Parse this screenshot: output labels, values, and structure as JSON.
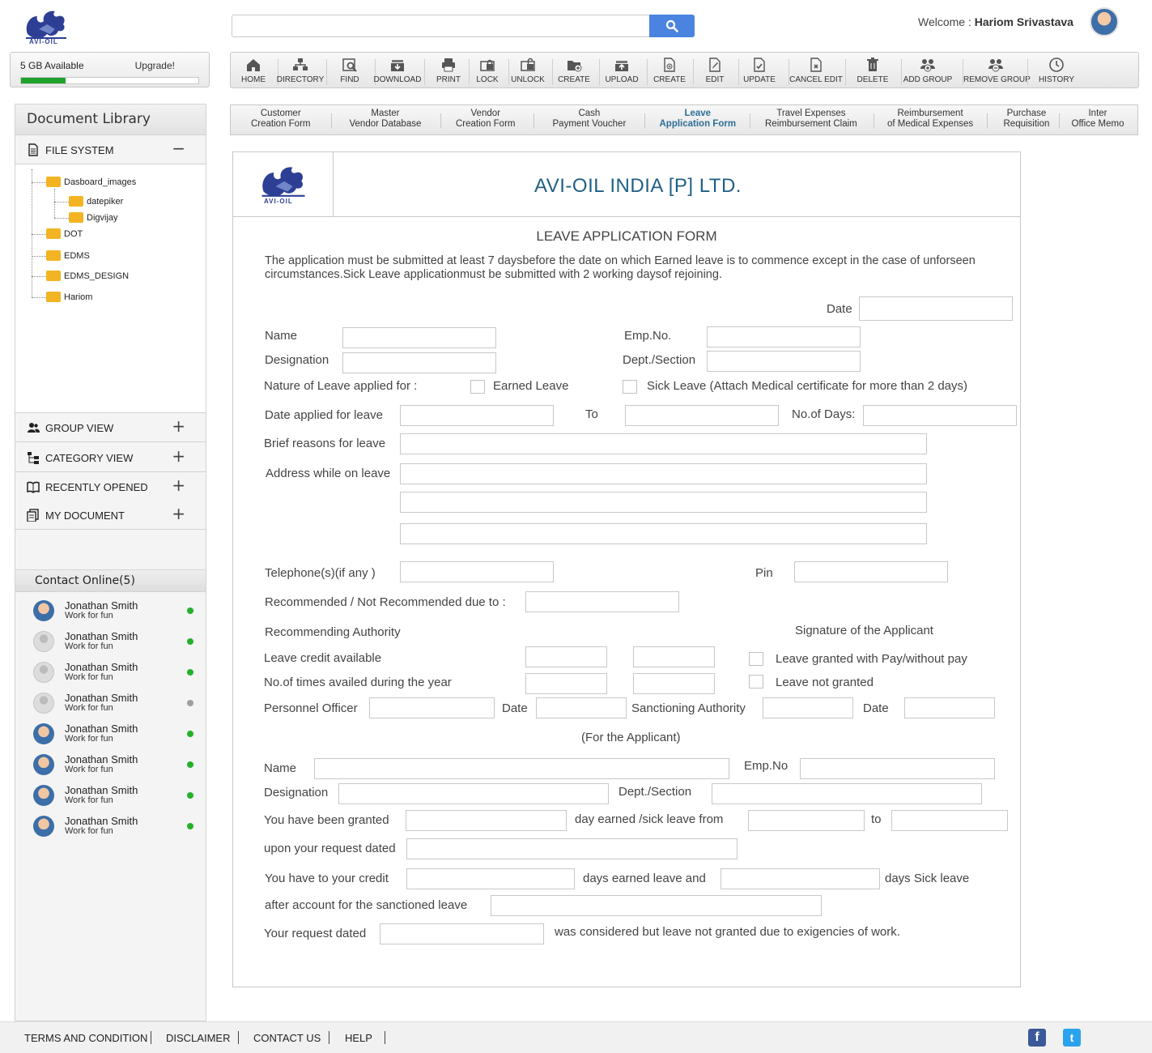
{
  "brand": {
    "logo_text": "AVI-OIL"
  },
  "storage": {
    "label": "5 GB Available",
    "upgrade": "Upgrade!",
    "used_fraction": 0.25
  },
  "search": {
    "placeholder": "",
    "value": ""
  },
  "user": {
    "welcome_label": "Welcome :",
    "name": "Hariom Srivastava"
  },
  "toolbar": [
    {
      "label": "HOME",
      "icon": "home-icon"
    },
    {
      "label": "DIRECTORY",
      "icon": "directory-icon"
    },
    {
      "label": "FIND",
      "icon": "find-icon"
    },
    {
      "label": "DOWNLOAD",
      "icon": "download-icon"
    },
    {
      "label": "PRINT",
      "icon": "print-icon"
    },
    {
      "label": "LOCK",
      "icon": "lock-icon"
    },
    {
      "label": "UNLOCK",
      "icon": "unlock-icon"
    },
    {
      "label": "CREATE",
      "icon": "create-folder-icon"
    },
    {
      "label": "UPLOAD",
      "icon": "upload-icon"
    },
    {
      "label": "CREATE",
      "icon": "create-document-icon"
    },
    {
      "label": "EDIT",
      "icon": "edit-icon"
    },
    {
      "label": "UPDATE",
      "icon": "update-icon"
    },
    {
      "label": "CANCEL EDIT",
      "icon": "cancel-edit-icon"
    },
    {
      "label": "DELETE",
      "icon": "delete-icon"
    },
    {
      "label": "ADD GROUP",
      "icon": "add-group-icon"
    },
    {
      "label": "REMOVE GROUP",
      "icon": "remove-group-icon"
    },
    {
      "label": "HISTORY",
      "icon": "history-icon"
    }
  ],
  "tabs": [
    {
      "line1": "Customer",
      "line2": "Creation Form"
    },
    {
      "line1": "Master",
      "line2": "Vendor Database"
    },
    {
      "line1": "Vendor",
      "line2": "Creation Form"
    },
    {
      "line1": "Cash",
      "line2": "Payment Voucher"
    },
    {
      "line1": "Leave",
      "line2": "Application Form",
      "active": true
    },
    {
      "line1": "Travel Expenses",
      "line2": "Reimbursement Claim"
    },
    {
      "line1": "Reimbursement",
      "line2": "of Medical Expenses"
    },
    {
      "line1": "Purchase",
      "line2": "Requisition"
    },
    {
      "line1": "Inter",
      "line2": "Office Memo"
    }
  ],
  "sidebar": {
    "title": "Document Library",
    "file_system": "FILE SYSTEM",
    "tree": [
      "Dasboard_images",
      "datepiker",
      "Digvijay",
      "DOT",
      "EDMS",
      "EDMS_DESIGN",
      "Hariom"
    ],
    "sections": [
      "GROUP VIEW",
      "CATEGORY VIEW",
      "RECENTLY OPENED",
      "MY DOCUMENT"
    ],
    "contacts_title": "Contact Online(5)",
    "contacts": [
      {
        "name": "Jonathan Smith",
        "status": "Work for fun",
        "online": true
      },
      {
        "name": "Jonathan Smith",
        "status": "Work for fun",
        "online": true
      },
      {
        "name": "Jonathan Smith",
        "status": "Work for fun",
        "online": true
      },
      {
        "name": "Jonathan Smith",
        "status": "Work for fun",
        "online": false
      },
      {
        "name": "Jonathan Smith",
        "status": "Work for fun",
        "online": true
      },
      {
        "name": "Jonathan Smith",
        "status": "Work for fun",
        "online": true
      },
      {
        "name": "Jonathan Smith",
        "status": "Work for fun",
        "online": true
      },
      {
        "name": "Jonathan Smith",
        "status": "Work for fun",
        "online": true
      }
    ]
  },
  "form": {
    "company": "AVI-OIL INDIA [P] LTD.",
    "title": "LEAVE APPLICATION FORM",
    "instructions": "The application must be submitted at least 7 daysbefore the date on which Earned leave is to commence except in the case of unforseen circumstances.Sick Leave applicationmust be submitted with 2 working daysof rejoining.",
    "date": "Date",
    "name": "Name",
    "emp_no": "Emp.No.",
    "designation": "Designation",
    "dept": "Dept./Section",
    "nature": "Nature of Leave applied for :",
    "earned": "Earned Leave",
    "sick": "Sick Leave (Attach Medical certificate for more than 2 days)",
    "date_applied": "Date applied for leave",
    "to": "To",
    "no_days": "No.of Days:",
    "brief": "Brief reasons for leave",
    "address": "Address while on leave",
    "telephone": "Telephone(s)(if any )",
    "pin": "Pin",
    "recommended": "Recommended / Not Recommended due to :",
    "rec_authority": "Recommending Authority",
    "signature": "Signature of the Applicant",
    "leave_credit": "Leave credit available",
    "granted_pay": "Leave granted with Pay/without pay",
    "times_availed": "No.of times availed during the year",
    "not_granted": "Leave not granted",
    "personnel": "Personnel Officer",
    "date2": "Date",
    "sanctioning": "Sanctioning Authority",
    "date3": "Date",
    "for_applicant": "(For the Applicant)",
    "name2": "Name",
    "emp_no2": "Emp.No",
    "designation2": "Designation",
    "dept2": "Dept./Section",
    "granted": "You have been granted",
    "day_from": "day earned /sick leave from",
    "to2": "to",
    "upon": "upon your request dated",
    "credit": "You have to your credit",
    "days_earned": "days earned leave and",
    "days_sick": "days Sick leave",
    "after": "after account for the sanctioned leave",
    "request": "Your request dated",
    "considered": "was considered but leave not granted due to exigencies of work."
  },
  "footer": {
    "links": [
      "TERMS AND CONDITION",
      "DISCLAIMER",
      "CONTACT US",
      "HELP"
    ],
    "facebook": "f",
    "twitter": "t"
  },
  "colors": {
    "accent": "#4a84e0",
    "company": "#1f5f86",
    "online": "#25b02c",
    "folder": "#f2b423"
  }
}
